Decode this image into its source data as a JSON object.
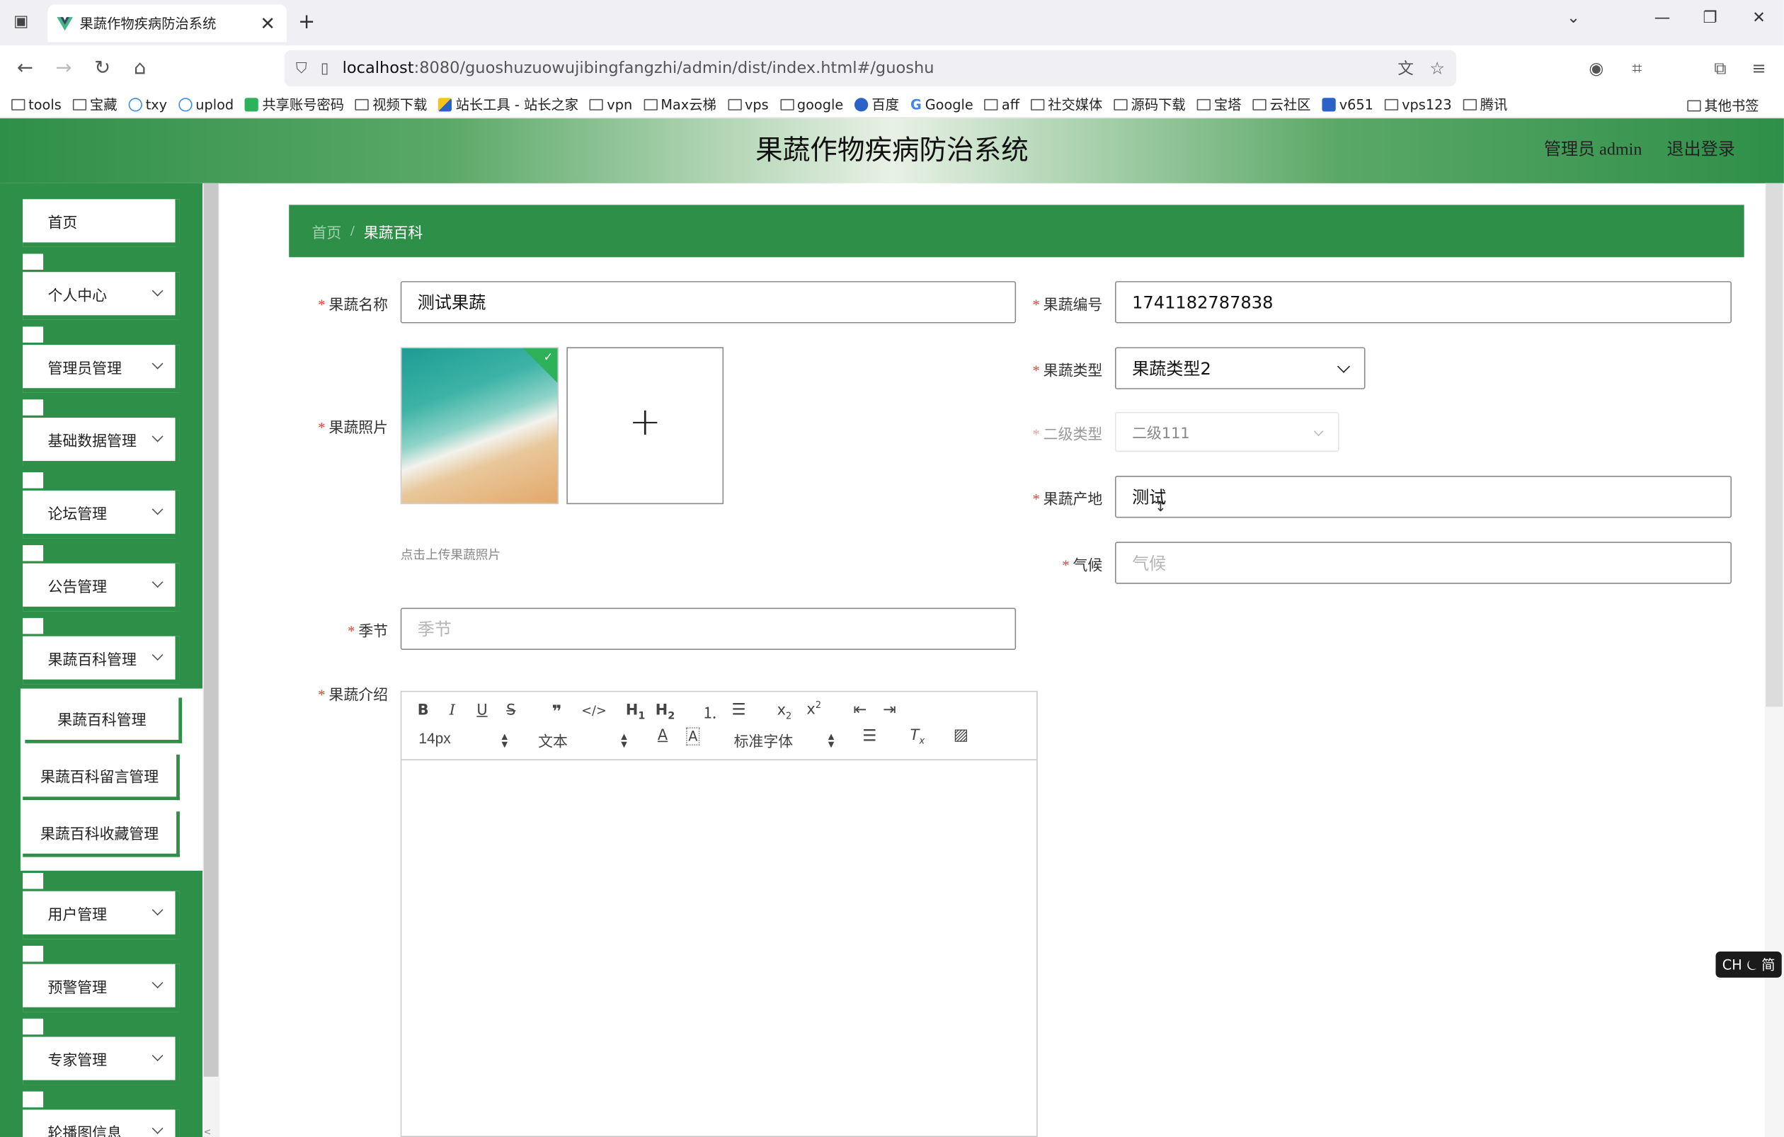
{
  "browser": {
    "tab_title": "果蔬作物疾病防治系统",
    "url_host": "localhost",
    "url_rest": ":8080/guoshuzuowujibingfangzhi/admin/dist/index.html#/guoshu",
    "bookmarks": [
      "tools",
      "宝藏",
      "txy",
      "uplod",
      "共享账号密码",
      "视频下载",
      "站长工具 - 站长之家",
      "vpn",
      "Max云梯",
      "vps",
      "google",
      "百度",
      "Google",
      "aff",
      "社交媒体",
      "源码下载",
      "宝塔",
      "云社区",
      "v651",
      "vps123",
      "腾讯"
    ],
    "other_bookmarks": "其他书签"
  },
  "header": {
    "system_title": "果蔬作物疾病防治系统",
    "user": "管理员 admin",
    "logout": "退出登录"
  },
  "sidebar": {
    "home": "首页",
    "menu": [
      "个人中心",
      "管理员管理",
      "基础数据管理",
      "论坛管理",
      "公告管理",
      "果蔬百科管理"
    ],
    "submenu": [
      "果蔬百科管理",
      "果蔬百科留言管理",
      "果蔬百科收藏管理"
    ],
    "menu2": [
      "用户管理",
      "预警管理",
      "专家管理",
      "轮播图信息"
    ]
  },
  "breadcrumb": {
    "home": "首页",
    "separator": "/",
    "current": "果蔬百科"
  },
  "form": {
    "name_label": "果蔬名称",
    "name_value": "测试果蔬",
    "code_label": "果蔬编号",
    "code_value": "1741182787838",
    "photo_label": "果蔬照片",
    "photo_hint": "点击上传果蔬照片",
    "type_label": "果蔬类型",
    "type_value": "果蔬类型2",
    "subtype_label": "二级类型",
    "subtype_value": "二级111",
    "origin_label": "果蔬产地",
    "origin_value": "测试",
    "climate_label": "气候",
    "climate_placeholder": "气候",
    "season_label": "季节",
    "season_placeholder": "季节",
    "intro_label": "果蔬介绍"
  },
  "editor": {
    "font_size": "14px",
    "paragraph": "文本",
    "font_family": "标准字体"
  },
  "ime": "CH ⏾ 简",
  "colors": {
    "brand_green": "#2e8f48",
    "required": "#e0453a"
  }
}
